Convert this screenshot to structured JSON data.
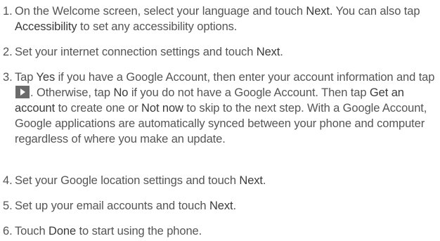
{
  "steps": [
    {
      "num": "1.",
      "segments": [
        {
          "t": "On the Welcome screen, select your language and touch ",
          "b": false
        },
        {
          "t": "Next.",
          "b": true
        },
        {
          "t": " You can also tap ",
          "b": false
        },
        {
          "t": "Accessibility",
          "b": true
        },
        {
          "t": " to set any accessibility options.",
          "b": false
        }
      ]
    },
    {
      "num": "2.",
      "segments": [
        {
          "t": "Set your internet connection settings and touch ",
          "b": false
        },
        {
          "t": "Next",
          "b": true
        },
        {
          "t": ".",
          "b": false
        }
      ]
    },
    {
      "num": "3.",
      "segments": [
        {
          "t": "Tap ",
          "b": false
        },
        {
          "t": "Yes",
          "b": true
        },
        {
          "t": " if you have a Google Account, then enter your account information and tap ",
          "b": false
        },
        {
          "icon": "next-arrow-icon"
        },
        {
          "t": ". Otherwise, tap ",
          "b": false
        },
        {
          "t": "No",
          "b": true
        },
        {
          "t": " if you do not have a Google Account. Then tap ",
          "b": false
        },
        {
          "t": "Get an account",
          "b": true
        },
        {
          "t": " to create one or ",
          "b": false
        },
        {
          "t": "Not now",
          "b": true
        },
        {
          "t": " to skip to the next step. With a Google Account, Google applications are automatically synced between your phone and computer regardless of where you make an update.",
          "b": false
        }
      ]
    },
    {
      "num": "4.",
      "segments": [
        {
          "t": "Set your Google location settings and touch ",
          "b": false
        },
        {
          "t": "Next",
          "b": true
        },
        {
          "t": ".",
          "b": false
        }
      ]
    },
    {
      "num": "5.",
      "segments": [
        {
          "t": "Set up your email accounts and touch ",
          "b": false
        },
        {
          "t": "Next",
          "b": true
        },
        {
          "t": ".",
          "b": false
        }
      ]
    },
    {
      "num": "6.",
      "segments": [
        {
          "t": "Touch ",
          "b": false
        },
        {
          "t": "Done",
          "b": true
        },
        {
          "t": " to start using the phone.",
          "b": false
        }
      ]
    }
  ]
}
